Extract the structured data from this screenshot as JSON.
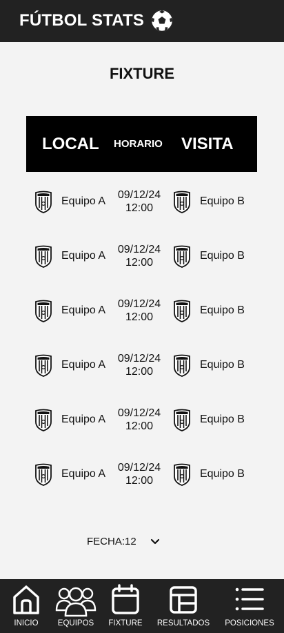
{
  "app": {
    "title": "FÚTBOL STATS",
    "logo_icon": "soccer-ball-icon"
  },
  "page": {
    "title": "FIXTURE"
  },
  "table_header": {
    "local": "LOCAL",
    "time": "HORARIO",
    "visit": "VISITA"
  },
  "matches": [
    {
      "local": "Equipo A",
      "date": "09/12/24",
      "time": "12:00",
      "visit": "Equipo B"
    },
    {
      "local": "Equipo A",
      "date": "09/12/24",
      "time": "12:00",
      "visit": "Equipo B"
    },
    {
      "local": "Equipo A",
      "date": "09/12/24",
      "time": "12:00",
      "visit": "Equipo B"
    },
    {
      "local": "Equipo A",
      "date": "09/12/24",
      "time": "12:00",
      "visit": "Equipo B"
    },
    {
      "local": "Equipo A",
      "date": "09/12/24",
      "time": "12:00",
      "visit": "Equipo B"
    },
    {
      "local": "Equipo A",
      "date": "09/12/24",
      "time": "12:00",
      "visit": "Equipo B"
    }
  ],
  "fecha": {
    "label": "FECHA:12"
  },
  "nav": {
    "inicio": "INICIO",
    "equipos": "EQUIPOS",
    "fixture": "FIXTURE",
    "resultados": "RESULTADOS",
    "posiciones": "POSICIONES"
  },
  "colors": {
    "bar": "#222222",
    "background": "#f3f3f3",
    "header": "#000000"
  }
}
